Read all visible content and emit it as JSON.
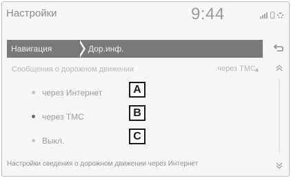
{
  "status_bar": {
    "title": "Настройки",
    "time": "9:44"
  },
  "breadcrumb": {
    "items": [
      "Навигация",
      "Дор.инф."
    ]
  },
  "setting": {
    "label": "Сообщения о дорожном движении",
    "value": "через TMC"
  },
  "options": [
    {
      "label": "через Интернет",
      "selected": false,
      "callout": "A"
    },
    {
      "label": "через TMC",
      "selected": true,
      "callout": "B"
    },
    {
      "label": "Выкл.",
      "selected": false,
      "callout": "C"
    }
  ],
  "footer": {
    "description": "Настройки сведения о дорожном движении через Интернет"
  },
  "icons": [
    "signal-icon",
    "phone-icon",
    "gear-icon",
    "back-icon",
    "scroll-up-icon",
    "scroll-down-icon",
    "chevron-icon"
  ]
}
